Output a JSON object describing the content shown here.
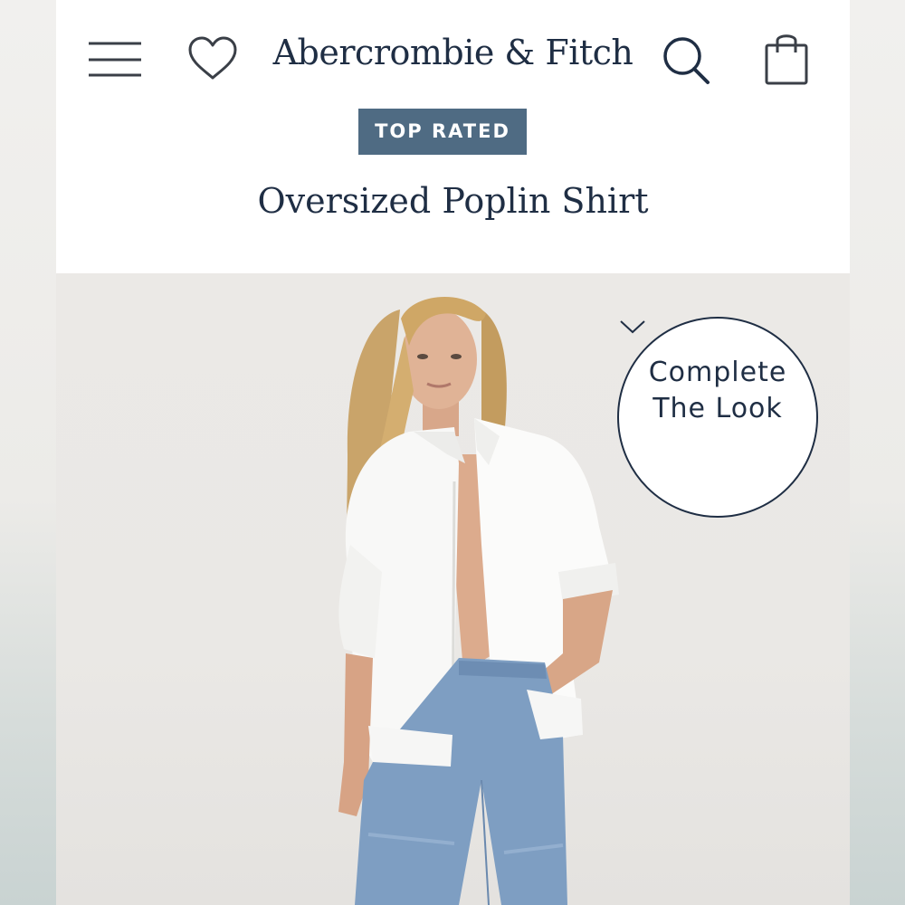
{
  "header": {
    "brand": "Abercrombie & Fitch",
    "icons": {
      "menu": "hamburger-menu-icon",
      "wishlist": "heart-icon",
      "search": "search-icon",
      "bag": "shopping-bag-icon"
    }
  },
  "product": {
    "badge": "TOP RATED",
    "title": "Oversized Poplin Shirt"
  },
  "complete_the_look": {
    "line1": "Complete",
    "line2": "The Look",
    "icon": "chevron-down-icon"
  },
  "colors": {
    "navy": "#1f2e44",
    "badge_bg": "#4f6b83",
    "header_bg": "#ffffff",
    "photo_bg": "#ebe9e6"
  }
}
